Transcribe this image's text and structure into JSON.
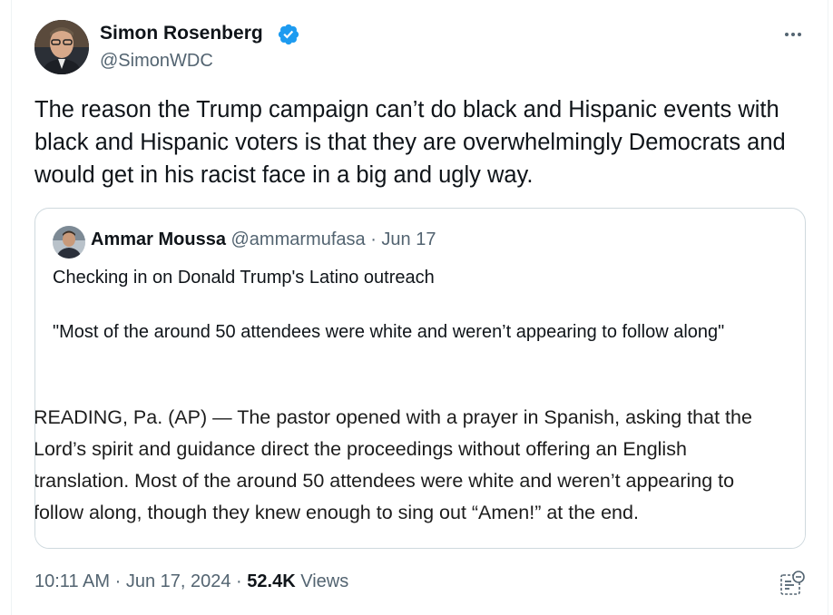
{
  "author": {
    "display_name": "Simon Rosenberg",
    "handle": "@SimonWDC",
    "avatar_icon": "avatar-photo",
    "verified_icon": "verified-badge-icon",
    "verified_color": "#1d9bf0"
  },
  "more_icon": "more-options-icon",
  "tweet": {
    "text": "The reason the Trump campaign can’t do black and Hispanic events with black and Hispanic voters is that they are overwhelmingly Democrats and would get in his racist face in a big and ugly way."
  },
  "quote": {
    "display_name": "Ammar Moussa",
    "handle": "@ammarmufasa",
    "separator": "·",
    "date": "Jun 17",
    "line1": "Checking in on Donald Trump's Latino outreach",
    "line2": "\"Most of the around 50 attendees were white and weren’t appearing to follow along\"",
    "image_lines": [
      "READING, Pa. (AP) — The pastor opened with a prayer in Spanish, asking that the",
      "Lord’s spirit and guidance direct the proceedings without offering an English",
      "translation. Most of the around 50 attendees were white and weren’t appearing to",
      "follow along, though they knew enough to sing out “Amen!” at the end."
    ]
  },
  "meta": {
    "time": "10:11 AM",
    "separator": "·",
    "date": "Jun 17, 2024",
    "separator2": "·",
    "views_count": "52.4K",
    "views_label": "Views"
  },
  "analytics_icon": "analytics-icon",
  "colors": {
    "text": "#0f1419",
    "secondary": "#536471",
    "border": "#cfd9de"
  }
}
